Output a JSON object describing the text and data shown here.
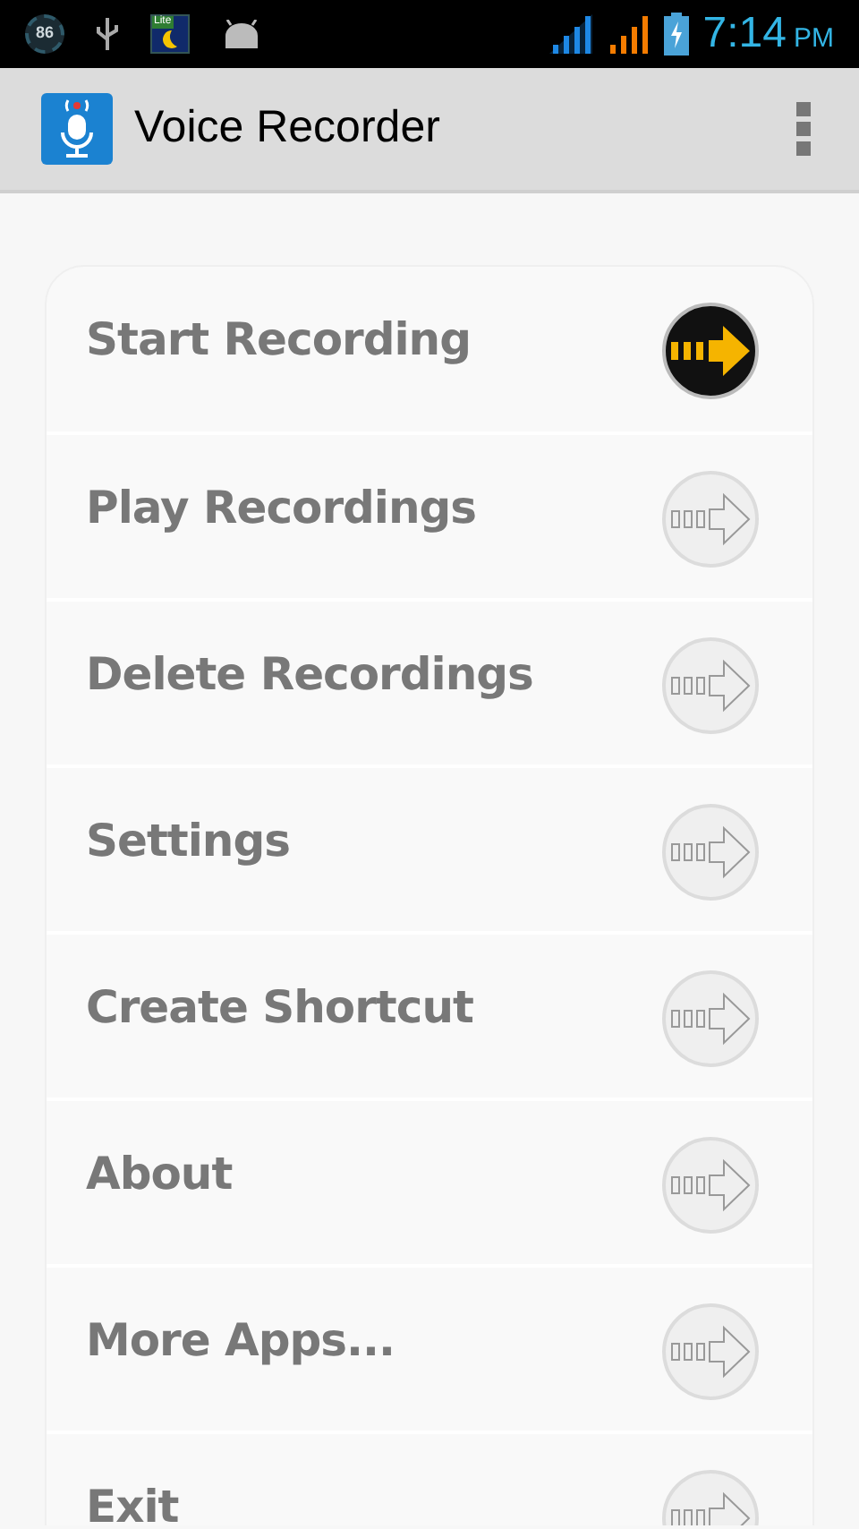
{
  "status_bar": {
    "badge": "86",
    "app_icon_label": "Lite",
    "time": "7:14",
    "meridiem": "PM"
  },
  "app_bar": {
    "title": "Voice Recorder"
  },
  "menu": [
    {
      "label": "Start Recording",
      "selected": true
    },
    {
      "label": "Play Recordings",
      "selected": false
    },
    {
      "label": "Delete Recordings",
      "selected": false
    },
    {
      "label": "Settings",
      "selected": false
    },
    {
      "label": "Create Shortcut",
      "selected": false
    },
    {
      "label": "About",
      "selected": false
    },
    {
      "label": "More Apps...",
      "selected": false
    },
    {
      "label": "Exit",
      "selected": false
    }
  ]
}
